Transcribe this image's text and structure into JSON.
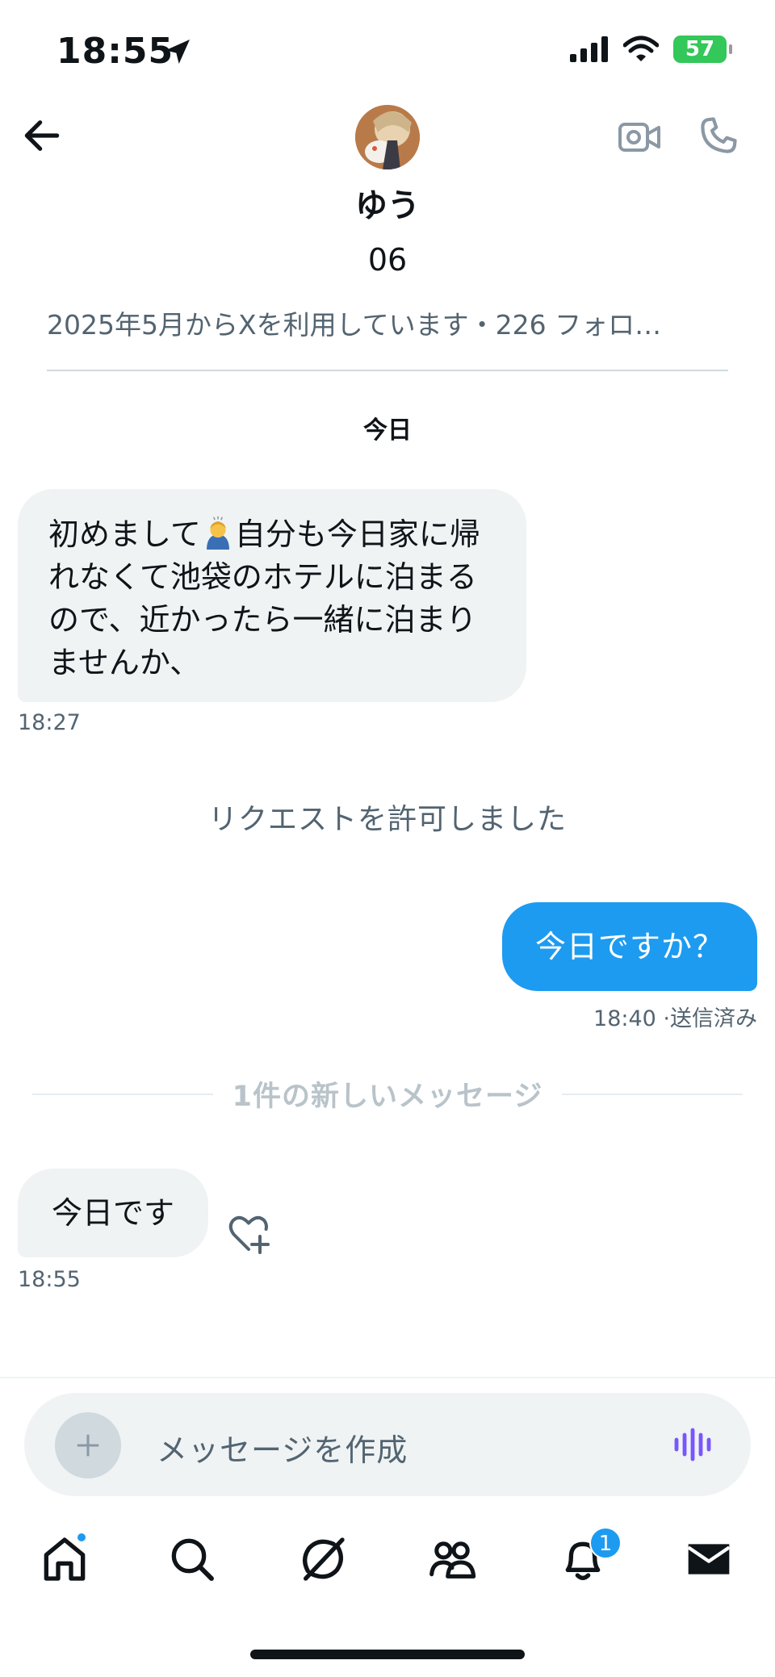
{
  "status_bar": {
    "time": "18:55",
    "battery": "57"
  },
  "header": {
    "name": "ゆう",
    "handle": "06",
    "since": "2025年5月からXを利用しています・226 フォロ…"
  },
  "conversation": {
    "day_label": "今日",
    "messages": [
      {
        "side": "in",
        "text_before_emoji": "初めまして",
        "text_after_emoji": "自分も今日家に帰れなくて池袋のホテルに泊まるので、近かったら一緒に泊まりませんか、",
        "time": "18:27"
      },
      {
        "side": "out",
        "text": "今日ですか？",
        "time": "18:40 ·送信済み"
      },
      {
        "side": "in",
        "text": "今日です",
        "time": "18:55"
      }
    ],
    "system_notice": "リクエストを許可しました",
    "new_messages_label": "1件の新しいメッセージ"
  },
  "composer": {
    "placeholder": "メッセージを作成"
  },
  "tabbar": {
    "notification_badge": "1"
  },
  "colors": {
    "accent": "#1d9bf0",
    "incoming_bubble": "#eff3f4",
    "secondary_text": "#536471",
    "battery": "#34c759",
    "voice": "#7856ff"
  }
}
